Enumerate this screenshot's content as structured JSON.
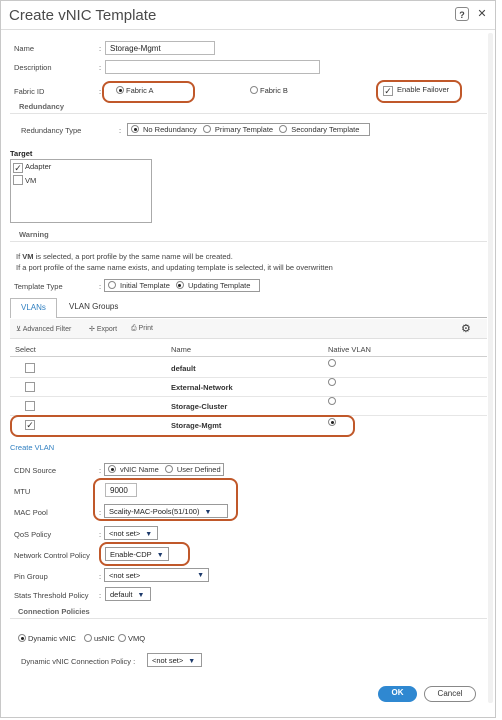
{
  "dialog": {
    "title": "Create vNIC Template",
    "help_label": "?",
    "close_label": "✕"
  },
  "form": {
    "name_label": "Name",
    "name_value": "Storage-Mgmt",
    "description_label": "Description",
    "description_value": "",
    "fabric_id_label": "Fabric ID",
    "fabric_a": "Fabric A",
    "fabric_b": "Fabric B",
    "enable_failover": "Enable Failover",
    "colon": ":"
  },
  "redundancy": {
    "heading": "Redundancy",
    "type_label": "Redundancy Type",
    "options": [
      "No Redundancy",
      "Primary Template",
      "Secondary Template"
    ],
    "selected": "No Redundancy"
  },
  "target": {
    "heading": "Target",
    "items": [
      {
        "label": "Adapter",
        "checked": true
      },
      {
        "label": "VM",
        "checked": false
      }
    ]
  },
  "warning": {
    "heading": "Warning",
    "line1_prefix": "If ",
    "line1_bold": "VM",
    "line1_suffix": " is selected, a port profile by the same name will be created.",
    "line2": "If a port profile of the same name exists, and updating template is selected, it will be overwritten"
  },
  "template_type": {
    "label": "Template Type",
    "options": [
      "Initial Template",
      "Updating Template"
    ],
    "selected": "Updating Template"
  },
  "tabs": [
    {
      "label": "VLANs",
      "active": true
    },
    {
      "label": "VLAN Groups",
      "active": false
    }
  ],
  "toolbar": {
    "filter": "Advanced Filter",
    "export": "Export",
    "print": "Print"
  },
  "vlan_table": {
    "headers": [
      "Select",
      "Name",
      "Native VLAN"
    ],
    "rows": [
      {
        "name": "default",
        "selected": false,
        "native": false
      },
      {
        "name": "External-Network",
        "selected": false,
        "native": false
      },
      {
        "name": "Storage-Cluster",
        "selected": false,
        "native": false
      },
      {
        "name": "Storage-Mgmt",
        "selected": true,
        "native": true
      }
    ]
  },
  "create_vlan": "Create VLAN",
  "cdn": {
    "label": "CDN Source",
    "options": [
      "vNIC Name",
      "User Defined"
    ],
    "selected": "vNIC Name"
  },
  "mtu": {
    "label": "MTU",
    "value": "9000"
  },
  "mac_pool": {
    "label": "MAC Pool",
    "value": "Scality-MAC-Pools(51/100)"
  },
  "qos_policy": {
    "label": "QoS Policy",
    "value": "<not set>"
  },
  "network_control": {
    "label": "Network Control Policy",
    "value": "Enable-CDP"
  },
  "pin_group": {
    "label": "Pin Group",
    "value": "<not set>"
  },
  "stats_threshold": {
    "label": "Stats Threshold Policy",
    "value": "default"
  },
  "connection_policies": {
    "heading": "Connection Policies",
    "options": [
      "Dynamic vNIC",
      "usNIC",
      "VMQ"
    ],
    "selected": "Dynamic vNIC",
    "dynamic_label": "Dynamic vNIC Connection Policy :",
    "dynamic_value": "<not set>"
  },
  "footer": {
    "ok": "OK",
    "cancel": "Cancel"
  },
  "colors": {
    "accent": "#2f7fc1",
    "highlight": "#c0582a"
  }
}
